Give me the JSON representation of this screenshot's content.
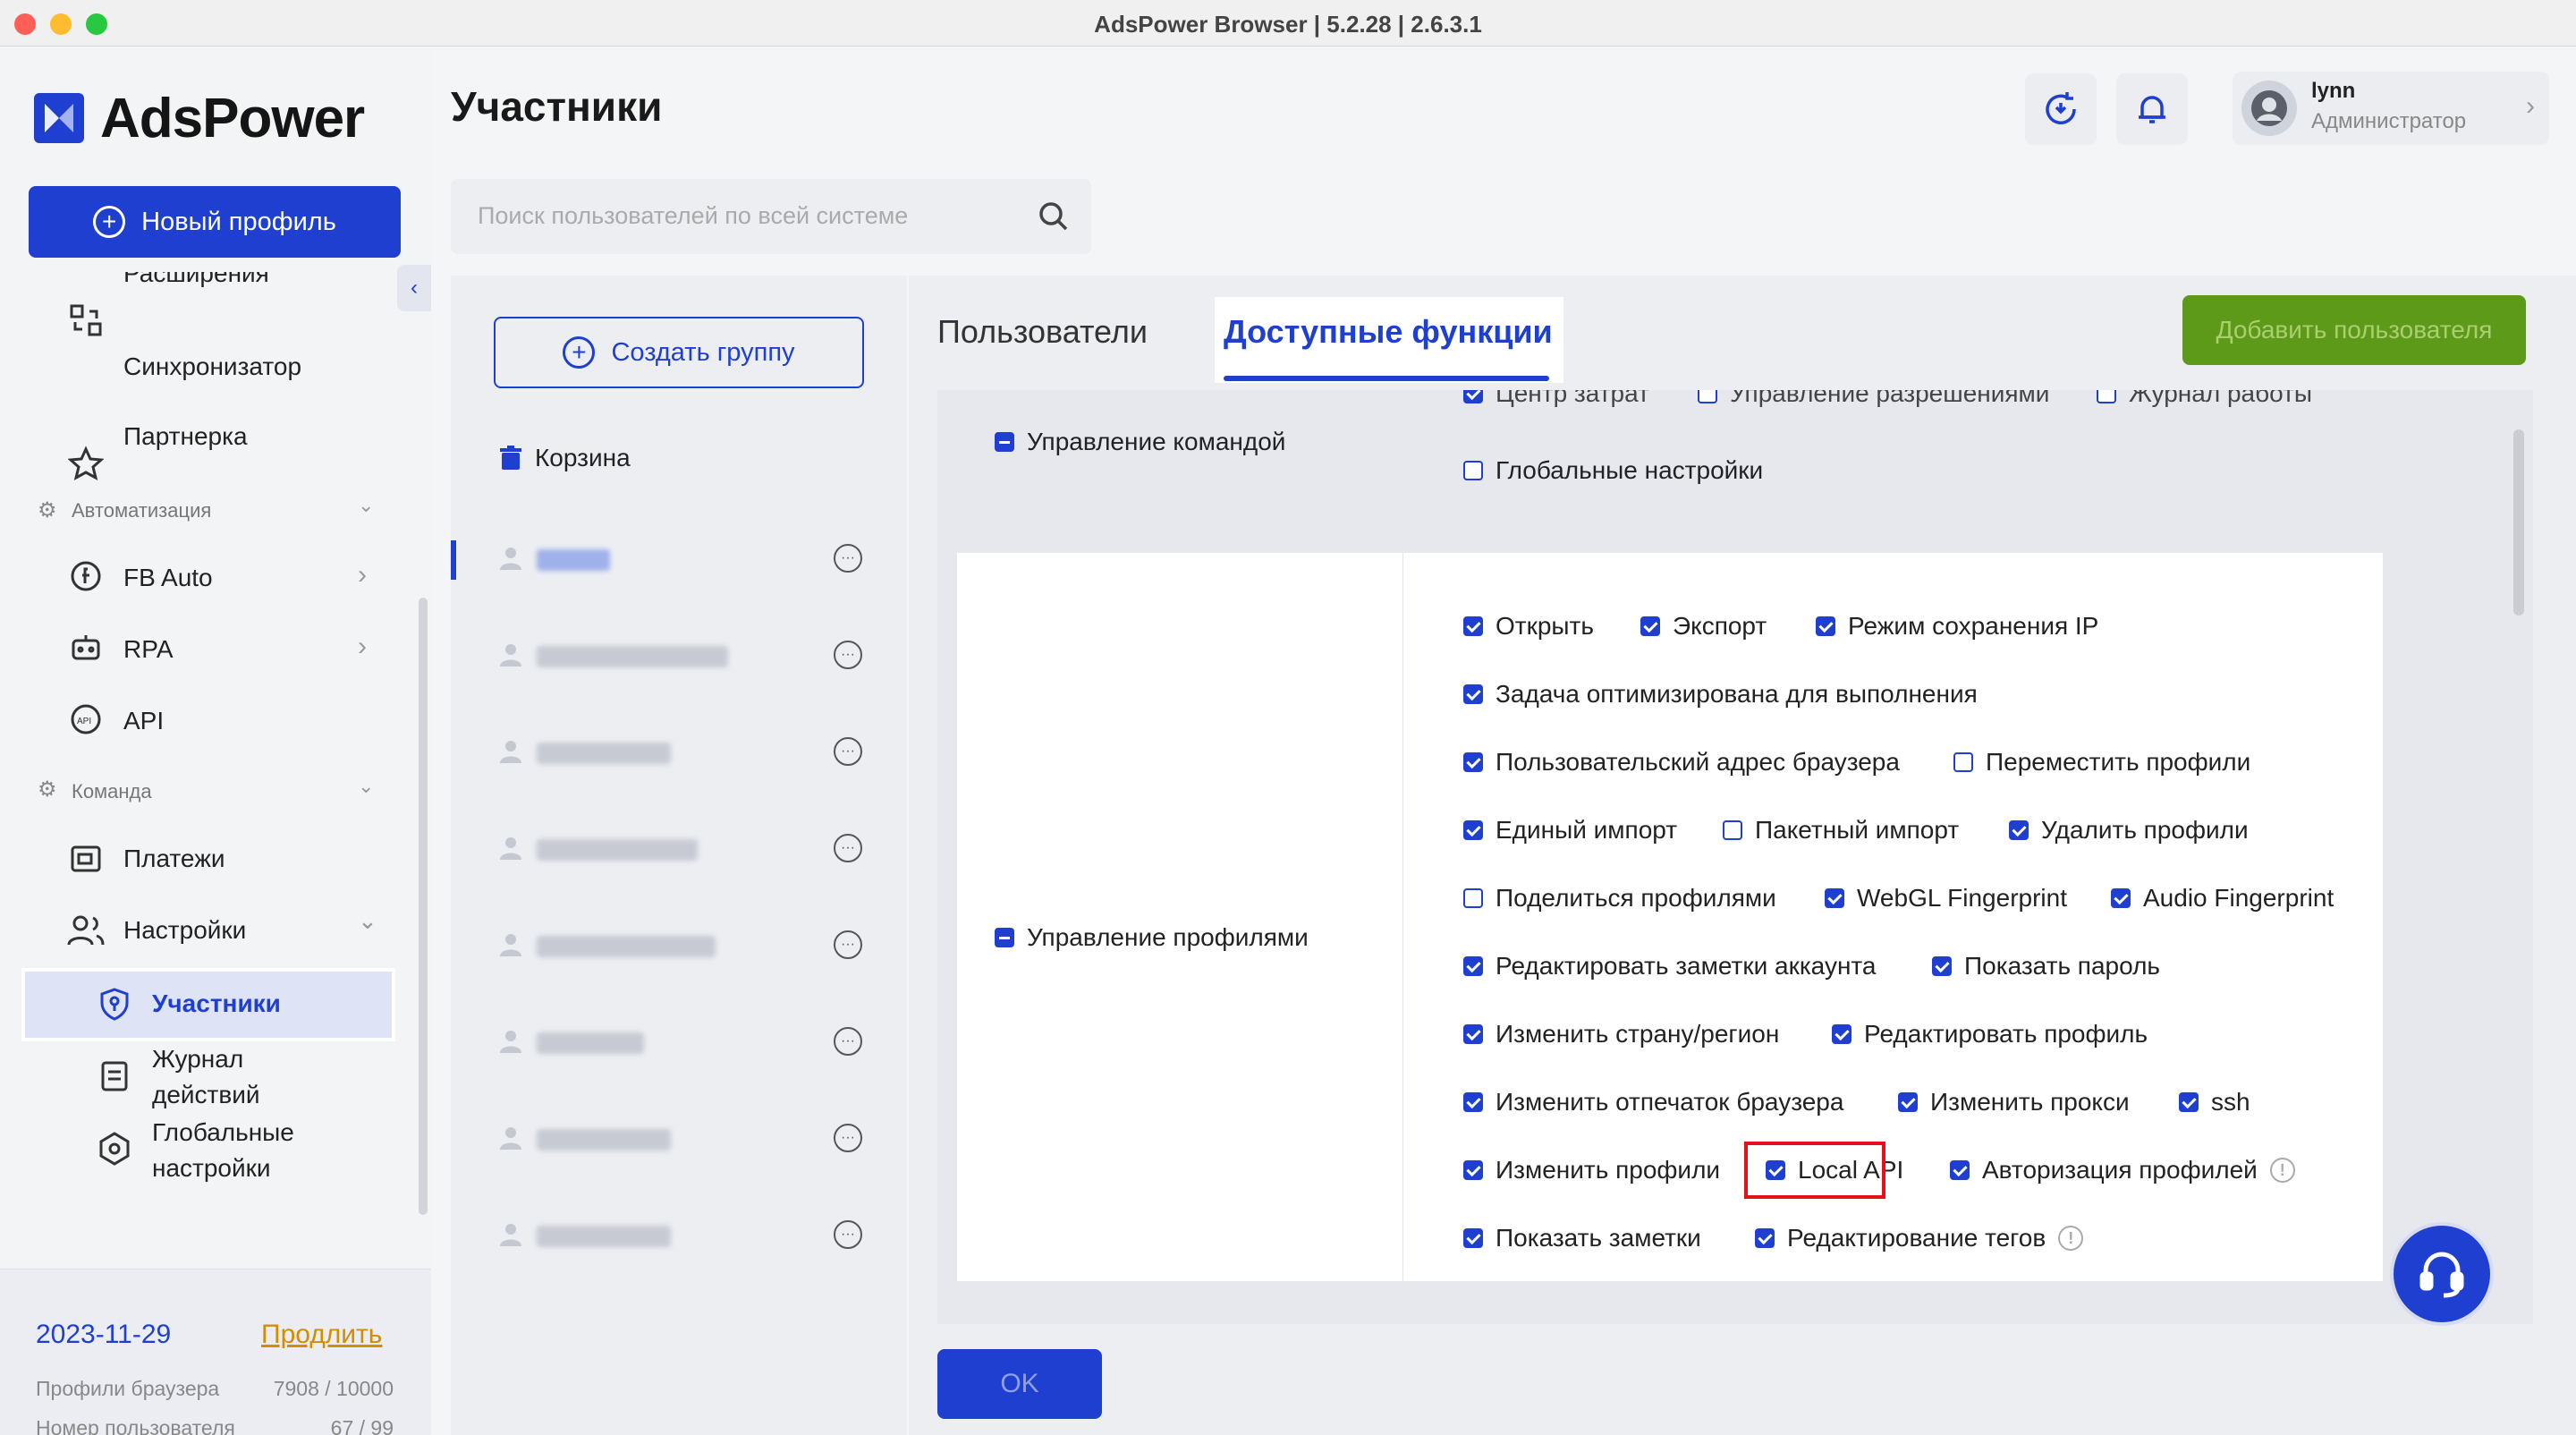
{
  "window": {
    "title": "AdsPower Browser | 5.2.28 | 2.6.3.1"
  },
  "brand": {
    "name": "AdsPower",
    "accent": "#1f3fd1"
  },
  "sidebar": {
    "new_profile": "Новый профиль",
    "partial_item": "Расширения",
    "items": [
      {
        "label": "Синхронизатор",
        "icon": "sync-icon"
      },
      {
        "label": "Партнерка",
        "icon": "star-icon"
      }
    ],
    "automation": {
      "title": "Автоматизация",
      "items": [
        {
          "label": "FB Auto",
          "icon": "fb-auto-icon"
        },
        {
          "label": "RPA",
          "icon": "robot-icon"
        },
        {
          "label": "API",
          "icon": "api-icon"
        }
      ]
    },
    "team": {
      "title": "Команда",
      "items": [
        {
          "label": "Платежи",
          "icon": "payments-icon"
        },
        {
          "label": "Настройки",
          "icon": "users-icon"
        }
      ],
      "sub_items": [
        {
          "label": "Участники",
          "icon": "shield-icon",
          "active": true
        },
        {
          "label": "Журнал действий",
          "icon": "log-icon"
        },
        {
          "label": "Глобальные настройки",
          "icon": "hexagon-icon"
        }
      ]
    },
    "footer": {
      "date": "2023-11-29",
      "renew": "Продлить",
      "rows": [
        {
          "label": "Профили браузера",
          "value": "7908 / 10000"
        },
        {
          "label": "Номер пользователя",
          "value": "67 / 99"
        }
      ]
    }
  },
  "header": {
    "title": "Участники",
    "user": {
      "name": "lynn",
      "role": "Администратор"
    }
  },
  "search": {
    "placeholder": "Поиск пользователей по всей системе"
  },
  "groups": {
    "create_label": "Создать группу",
    "trash_label": "Корзина",
    "rows": 8
  },
  "tabs": [
    {
      "label": "Пользователи",
      "active": false
    },
    {
      "label": "Доступные функции",
      "active": true
    }
  ],
  "add_user_label": "Добавить пользователя",
  "permissions": {
    "team_management": {
      "label": "Управление командой",
      "partial_top": [
        {
          "label": "Центр затрат",
          "checked": true
        },
        {
          "label": "Управление разрешениями",
          "checked": false
        },
        {
          "label": "Журнал работы",
          "checked": false
        }
      ],
      "items": [
        {
          "label": "Глобальные настройки",
          "checked": false
        }
      ]
    },
    "profile_management": {
      "label": "Управление профилями",
      "rows": [
        [
          {
            "label": "Открыть",
            "checked": true
          },
          {
            "label": "Экспорт",
            "checked": true
          },
          {
            "label": "Режим сохранения IP",
            "checked": true
          }
        ],
        [
          {
            "label": "Задача оптимизирована для выполнения",
            "checked": true
          }
        ],
        [
          {
            "label": "Пользовательский адрес браузера",
            "checked": true
          },
          {
            "label": "Переместить профили",
            "checked": false
          }
        ],
        [
          {
            "label": "Единый импорт",
            "checked": true
          },
          {
            "label": "Пакетный импорт",
            "checked": false
          },
          {
            "label": "Удалить профили",
            "checked": true
          }
        ],
        [
          {
            "label": "Поделиться профилями",
            "checked": false
          },
          {
            "label": "WebGL Fingerprint",
            "checked": true
          },
          {
            "label": "Audio Fingerprint",
            "checked": true
          }
        ],
        [
          {
            "label": "Редактировать заметки аккаунта",
            "checked": true
          },
          {
            "label": "Показать пароль",
            "checked": true
          }
        ],
        [
          {
            "label": "Изменить страну/регион",
            "checked": true
          },
          {
            "label": "Редактировать профиль",
            "checked": true
          }
        ],
        [
          {
            "label": "Изменить отпечаток браузера",
            "checked": true
          },
          {
            "label": "Изменить прокси",
            "checked": true
          },
          {
            "label": "ssh",
            "checked": true
          }
        ],
        [
          {
            "label": "Изменить профили",
            "checked": true
          },
          {
            "label": "Local API",
            "checked": true
          },
          {
            "label": "Авторизация профилей",
            "checked": true
          }
        ],
        [
          {
            "label": "Показать заметки",
            "checked": true
          },
          {
            "label": "Редактирование тегов",
            "checked": true
          }
        ]
      ]
    }
  },
  "ok_label": "OK"
}
